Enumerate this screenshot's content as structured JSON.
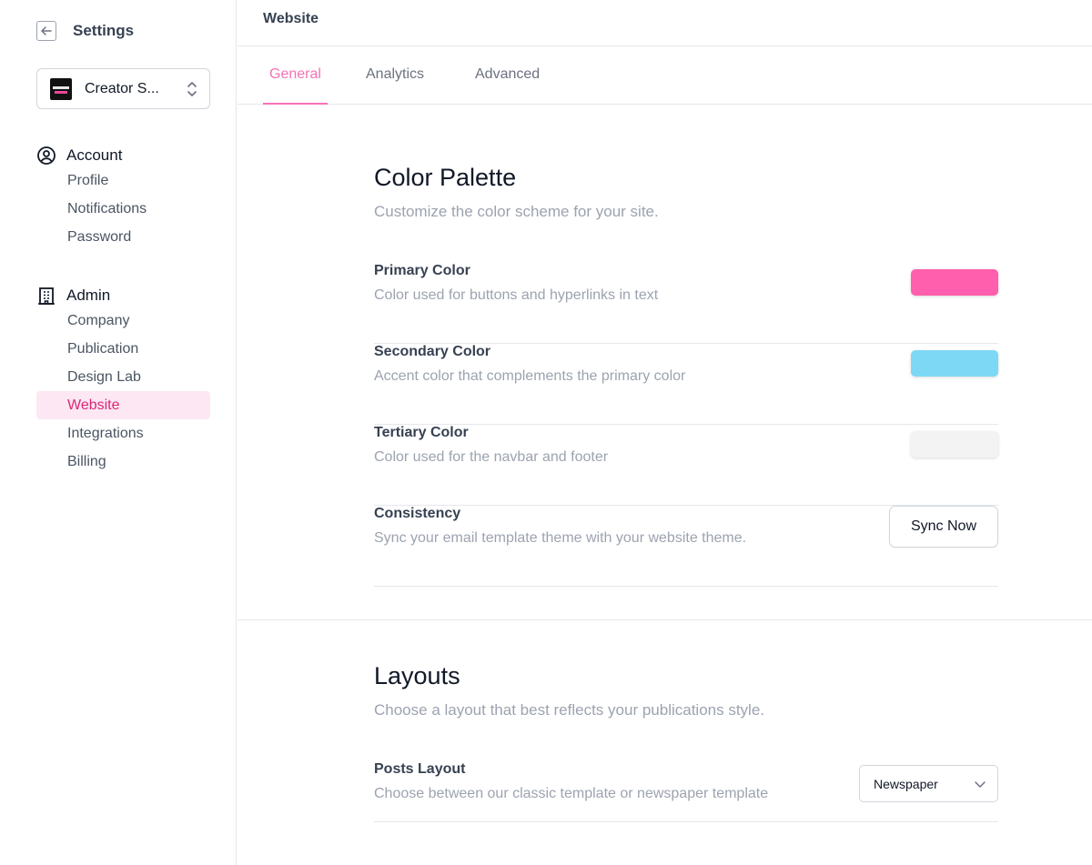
{
  "sidebar": {
    "title": "Settings",
    "publication": "Creator S...",
    "groups": [
      {
        "label": "Account",
        "icon": "user-circle-icon",
        "items": [
          "Profile",
          "Notifications",
          "Password"
        ]
      },
      {
        "label": "Admin",
        "icon": "building-icon",
        "items": [
          "Company",
          "Publication",
          "Design Lab",
          "Website",
          "Integrations",
          "Billing"
        ]
      }
    ],
    "active_item": "Website"
  },
  "header": {
    "title": "Website"
  },
  "tabs": [
    {
      "label": "General",
      "active": true
    },
    {
      "label": "Analytics",
      "active": false
    },
    {
      "label": "Advanced",
      "active": false
    }
  ],
  "color_palette": {
    "title": "Color Palette",
    "subtitle": "Customize the color scheme for your site.",
    "rows": [
      {
        "label": "Primary Color",
        "desc": "Color used for buttons and hyperlinks in text",
        "color": "#ff5fad"
      },
      {
        "label": "Secondary Color",
        "desc": "Accent color that complements the primary color",
        "color": "#7dd8f5"
      },
      {
        "label": "Tertiary Color",
        "desc": "Color used for the navbar and footer",
        "color": "#f3f3f3"
      }
    ],
    "consistency": {
      "label": "Consistency",
      "desc": "Sync your email template theme with your website theme.",
      "button": "Sync Now"
    }
  },
  "layouts": {
    "title": "Layouts",
    "subtitle": "Choose a layout that best reflects your publications style.",
    "posts_layout": {
      "label": "Posts Layout",
      "desc": "Choose between our classic template or newspaper template",
      "value": "Newspaper"
    }
  },
  "colors": {
    "accent": "#ec4899",
    "active_bg": "#fce7f3"
  }
}
